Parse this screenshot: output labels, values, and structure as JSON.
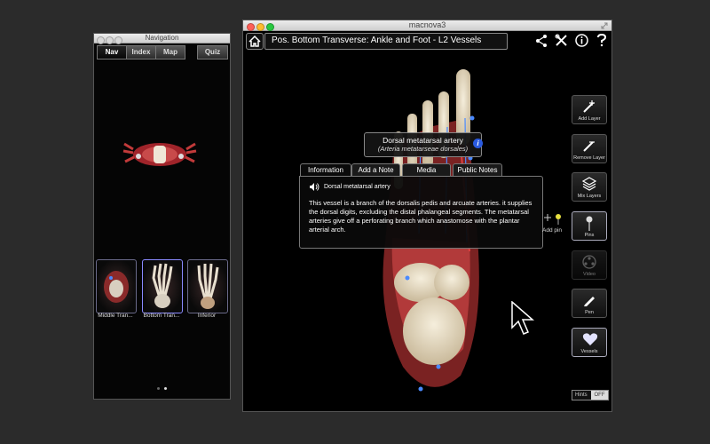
{
  "navwindow": {
    "title": "Navigation",
    "tabs": [
      {
        "label": "Nav",
        "active": true
      },
      {
        "label": "Index",
        "active": false
      },
      {
        "label": "Map",
        "active": false
      },
      {
        "label": "Quiz",
        "active": false
      }
    ],
    "thumbnails": [
      {
        "label": "Middle Tran..."
      },
      {
        "label": "Bottom Tran..."
      },
      {
        "label": "Inferior"
      }
    ],
    "page_count": 2,
    "current_page": 2
  },
  "mainwindow": {
    "title": "macnova3",
    "view_title": "Pos. Bottom Transverse: Ankle and Foot - L2 Vessels",
    "toolbar_icons": [
      "home-icon",
      "share-icon",
      "tools-icon",
      "info-icon",
      "help-icon"
    ],
    "popup": {
      "name": "Dorsal metatarsal artery",
      "latin": "(Arteria metatarseae dorsales)",
      "info_icon": "i",
      "tabs": [
        "Information",
        "Add a Note",
        "Media",
        "Public Notes"
      ],
      "active_tab": "Information",
      "audio_label": "Dorsal metatarsal artery",
      "description": "This vessel is a branch of the dorsalis pedis and arcuate arteries. it supplies the dorsal digits, excluding the distal phalangeal segments. The metatarsal arteries give off a perforating branch which anastomose with the plantar arterial arch."
    },
    "add_pin_label": "Add pin",
    "sidebar": [
      {
        "label": "Add Layer",
        "icon": "add-layer-icon"
      },
      {
        "label": "Remove Layer",
        "icon": "remove-layer-icon"
      },
      {
        "label": "Mix Layers",
        "icon": "layers-icon"
      },
      {
        "label": "Pins",
        "icon": "pin-icon"
      },
      {
        "label": "Video",
        "icon": "video-icon"
      },
      {
        "label": "Pen",
        "icon": "pen-icon"
      },
      {
        "label": "Vessels",
        "icon": "heart-icon"
      }
    ],
    "hints": {
      "label": "Hints",
      "state": "OFF"
    }
  },
  "colors": {
    "desktop": "#2b2b2b",
    "window_bg": "#000000",
    "accent_blue": "#4a8aff",
    "panel_border": "#777777"
  }
}
